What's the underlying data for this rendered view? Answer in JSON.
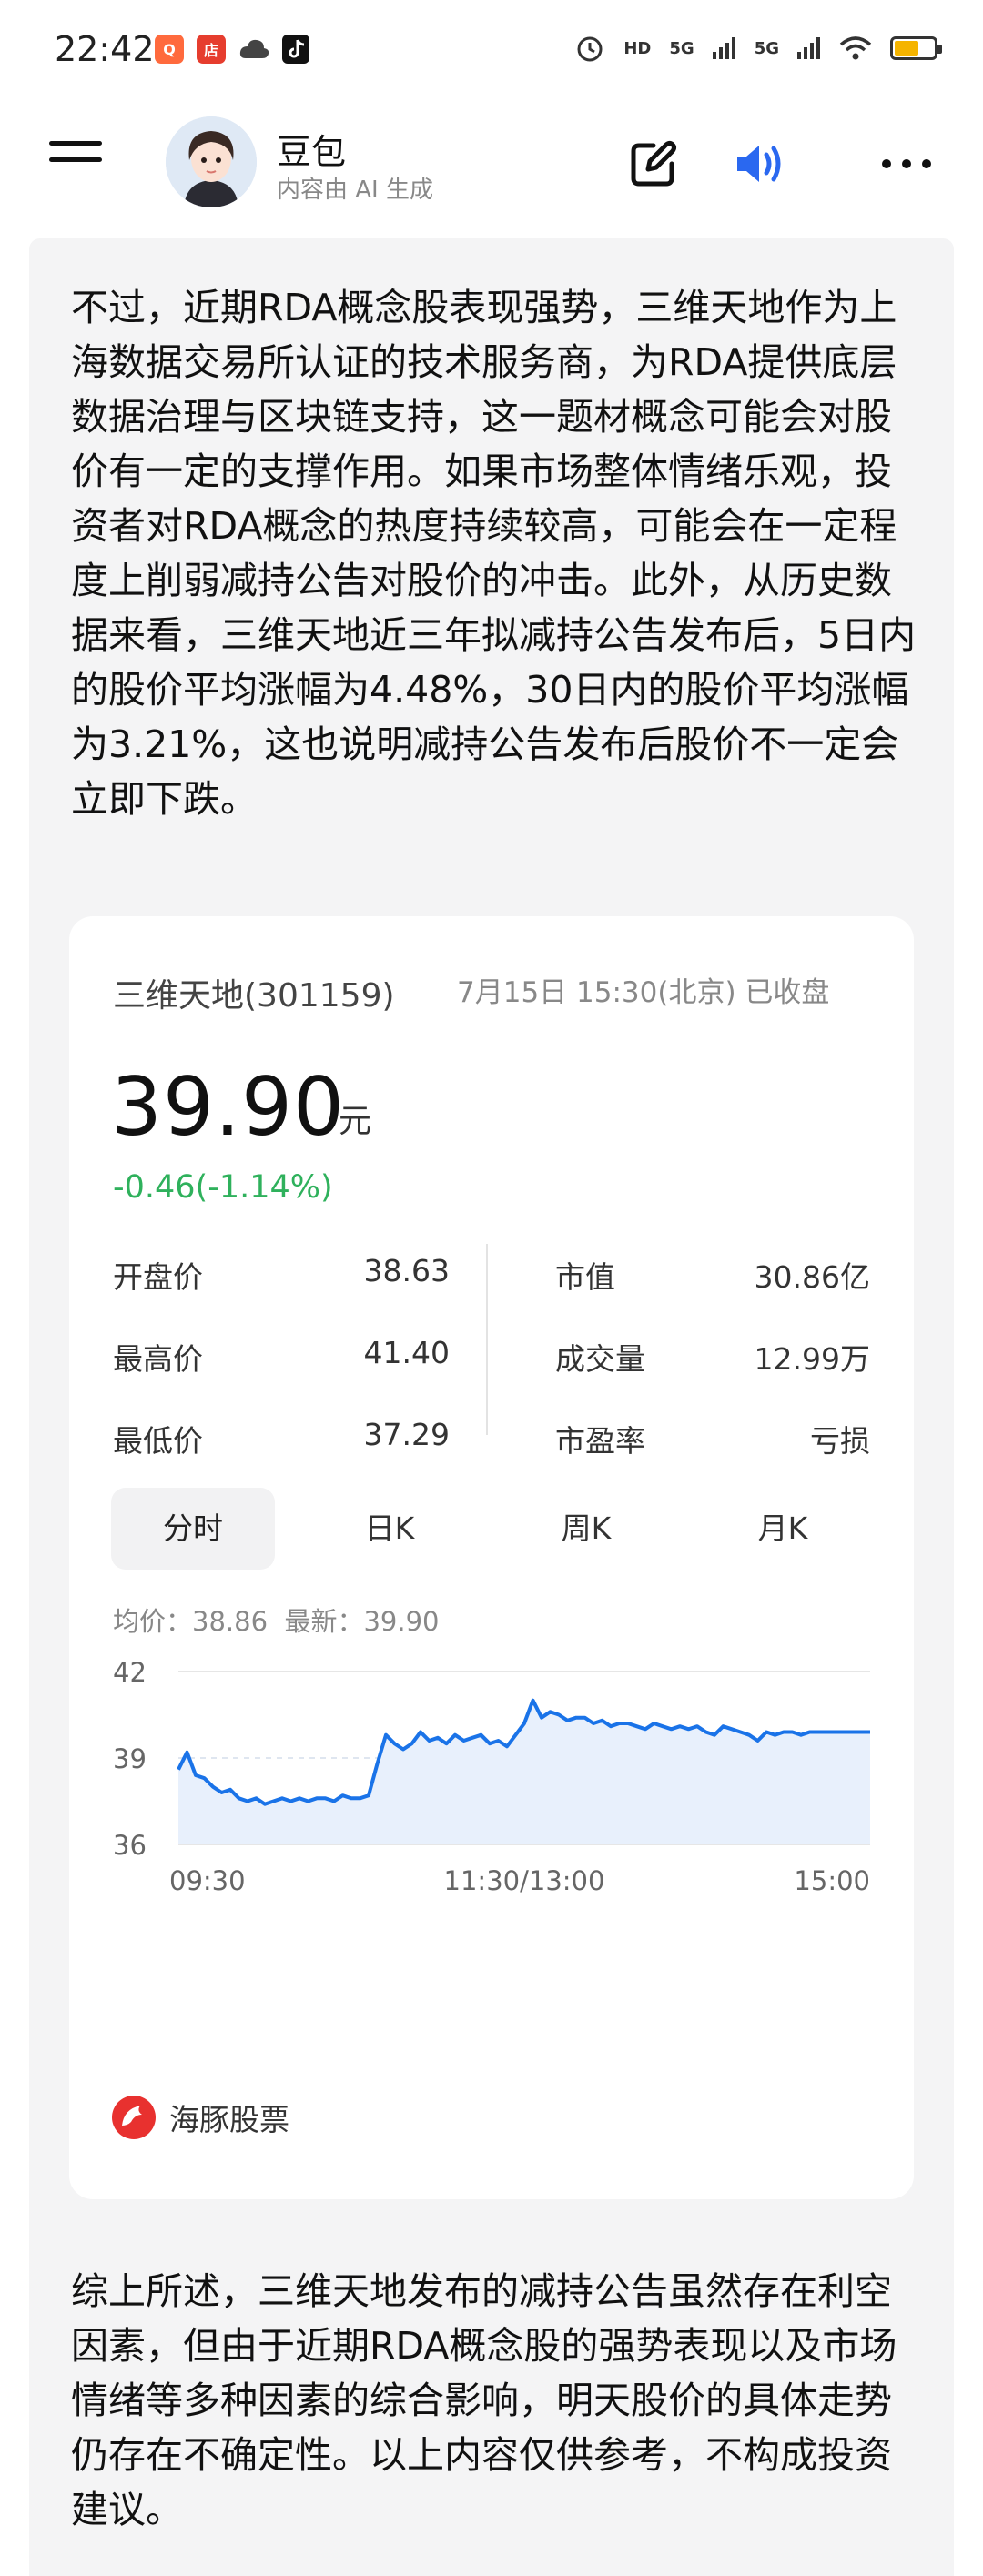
{
  "status_bar": {
    "time": "22:42",
    "signal_1": "5G",
    "signal_2": "5G",
    "hd_label": "HD"
  },
  "header": {
    "bot_name": "豆包",
    "subtitle": "内容由 AI 生成"
  },
  "content": {
    "paragraph_1": "不过，近期RDA概念股表现强势，三维天地作为上海数据交易所认证的技术服务商，为RDA提供底层数据治理与区块链支持，这一题材概念可能会对股价有一定的支撑作用。如果市场整体情绪乐观，投资者对RDA概念的热度持续较高，可能会在一定程度上削弱减持公告对股价的冲击。此外，从历史数据来看，三维天地近三年拟减持公告发布后，5日内的股价平均涨幅为4.48%，30日内的股价平均涨幅为3.21%，这也说明减持公告发布后股价不一定会立即下跌。",
    "paragraph_2": "综上所述，三维天地发布的减持公告虽然存在利空因素，但由于近期RDA概念股的强势表现以及市场情绪等多种因素的综合影响，明天股价的具体走势仍存在不确定性。以上内容仅供参考，不构成投资建议。"
  },
  "stock_card": {
    "name": "三维天地(301159)",
    "time_status": "7月15日 15:30(北京) 已收盘",
    "price": "39.90",
    "currency": "元",
    "change": "-0.46(-1.14%)",
    "change_color": "#2fb15c",
    "stats": {
      "open_label": "开盘价",
      "open_value": "38.63",
      "high_label": "最高价",
      "high_value": "41.40",
      "low_label": "最低价",
      "low_value": "37.29",
      "mcap_label": "市值",
      "mcap_value": "30.86亿",
      "volume_label": "成交量",
      "volume_value": "12.99万",
      "pe_label": "市盈率",
      "pe_value": "亏损"
    },
    "tabs": [
      "分时",
      "日K",
      "周K",
      "月K"
    ],
    "active_tab": "分时",
    "avg_label": "均价：38.86",
    "latest_label": "最新：39.90",
    "brand": "海豚股票"
  },
  "chart_data": {
    "type": "line",
    "ylim": [
      36,
      42
    ],
    "y_ticks": [
      "42",
      "39",
      "36"
    ],
    "x_ticks": [
      "09:30",
      "11:30/13:00",
      "15:00"
    ],
    "line_color": "#1a73e8",
    "fill_color": "#e8f0fc",
    "x": [
      0,
      3,
      6,
      9,
      12,
      15,
      18,
      21,
      24,
      27,
      30,
      33,
      36,
      39,
      42,
      45,
      48,
      51,
      54,
      57,
      60,
      63,
      66,
      69,
      72,
      75,
      78,
      81,
      84,
      87,
      90,
      93,
      96,
      99,
      102,
      105,
      108,
      111,
      114,
      117,
      120,
      123,
      126,
      129,
      132,
      135,
      138,
      141,
      144,
      147,
      150,
      153,
      156,
      159,
      162,
      165,
      168,
      171,
      174,
      177,
      180,
      183,
      186,
      189,
      192,
      195,
      198,
      201,
      204,
      207,
      210,
      213,
      216,
      219,
      222,
      225,
      228,
      231,
      234,
      237,
      240
    ],
    "values": [
      38.6,
      39.2,
      38.4,
      38.3,
      38.0,
      37.8,
      37.9,
      37.6,
      37.5,
      37.6,
      37.4,
      37.5,
      37.6,
      37.5,
      37.6,
      37.5,
      37.6,
      37.6,
      37.5,
      37.7,
      37.6,
      37.6,
      37.7,
      38.8,
      39.8,
      39.5,
      39.3,
      39.5,
      39.9,
      39.6,
      39.7,
      39.5,
      39.8,
      39.6,
      39.7,
      39.8,
      39.5,
      39.6,
      39.4,
      39.8,
      40.2,
      41.0,
      40.4,
      40.6,
      40.5,
      40.3,
      40.4,
      40.4,
      40.2,
      40.3,
      40.1,
      40.2,
      40.2,
      40.1,
      40.0,
      40.2,
      40.1,
      40.0,
      40.1,
      40.0,
      40.1,
      39.9,
      39.8,
      40.1,
      40.0,
      39.9,
      39.8,
      39.6,
      39.9,
      39.8,
      39.9,
      39.9,
      39.8,
      39.9,
      39.9,
      39.9,
      39.9,
      39.9,
      39.9,
      39.9,
      39.9
    ]
  }
}
